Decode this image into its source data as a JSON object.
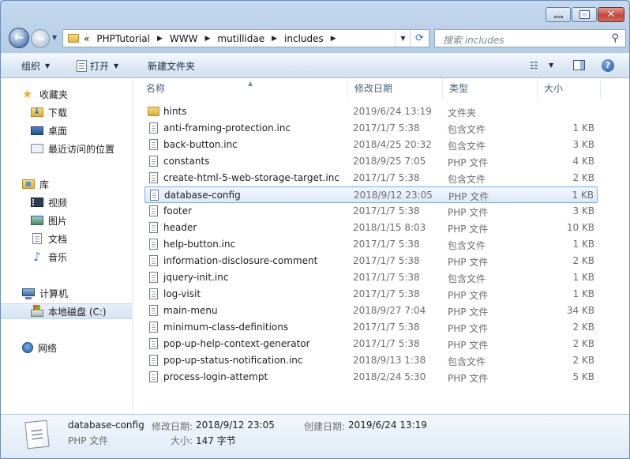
{
  "title_bar": {
    "minimize": "minimize",
    "maximize": "maximize",
    "close": "close"
  },
  "address": {
    "overflow": "«",
    "crumbs": [
      "PHPTutorial",
      "WWW",
      "mutillidae",
      "includes"
    ]
  },
  "search": {
    "placeholder": "搜索 includes"
  },
  "toolbar": {
    "organize": "组织",
    "open": "打开",
    "new_folder": "新建文件夹"
  },
  "sidebar": {
    "favorites": {
      "header": "收藏夹",
      "items": [
        "下载",
        "桌面",
        "最近访问的位置"
      ]
    },
    "libraries": {
      "header": "库",
      "items": [
        "视频",
        "图片",
        "文档",
        "音乐"
      ]
    },
    "computer": {
      "header": "计算机",
      "items": [
        "本地磁盘 (C:)"
      ]
    },
    "network": {
      "header": "网络"
    }
  },
  "columns": {
    "name": "名称",
    "date": "修改日期",
    "type": "类型",
    "size": "大小"
  },
  "files": [
    {
      "name": "hints",
      "date": "2019/6/24 13:19",
      "type": "文件夹",
      "size": "",
      "kind": "folder"
    },
    {
      "name": "anti-framing-protection.inc",
      "date": "2017/1/7 5:38",
      "type": "包含文件",
      "size": "1 KB",
      "kind": "file"
    },
    {
      "name": "back-button.inc",
      "date": "2018/4/25 20:32",
      "type": "包含文件",
      "size": "3 KB",
      "kind": "file"
    },
    {
      "name": "constants",
      "date": "2018/9/25 7:05",
      "type": "PHP 文件",
      "size": "4 KB",
      "kind": "file"
    },
    {
      "name": "create-html-5-web-storage-target.inc",
      "date": "2017/1/7 5:38",
      "type": "包含文件",
      "size": "2 KB",
      "kind": "file"
    },
    {
      "name": "database-config",
      "date": "2018/9/12 23:05",
      "type": "PHP 文件",
      "size": "1 KB",
      "kind": "file",
      "selected": true
    },
    {
      "name": "footer",
      "date": "2017/1/7 5:38",
      "type": "PHP 文件",
      "size": "3 KB",
      "kind": "file"
    },
    {
      "name": "header",
      "date": "2018/1/15 8:03",
      "type": "PHP 文件",
      "size": "10 KB",
      "kind": "file"
    },
    {
      "name": "help-button.inc",
      "date": "2017/1/7 5:38",
      "type": "包含文件",
      "size": "1 KB",
      "kind": "file"
    },
    {
      "name": "information-disclosure-comment",
      "date": "2017/1/7 5:38",
      "type": "PHP 文件",
      "size": "2 KB",
      "kind": "file"
    },
    {
      "name": "jquery-init.inc",
      "date": "2017/1/7 5:38",
      "type": "包含文件",
      "size": "1 KB",
      "kind": "file"
    },
    {
      "name": "log-visit",
      "date": "2017/1/7 5:38",
      "type": "PHP 文件",
      "size": "1 KB",
      "kind": "file"
    },
    {
      "name": "main-menu",
      "date": "2018/9/27 7:04",
      "type": "PHP 文件",
      "size": "34 KB",
      "kind": "file"
    },
    {
      "name": "minimum-class-definitions",
      "date": "2017/1/7 5:38",
      "type": "PHP 文件",
      "size": "2 KB",
      "kind": "file"
    },
    {
      "name": "pop-up-help-context-generator",
      "date": "2017/1/7 5:38",
      "type": "PHP 文件",
      "size": "2 KB",
      "kind": "file"
    },
    {
      "name": "pop-up-status-notification.inc",
      "date": "2018/9/13 1:38",
      "type": "包含文件",
      "size": "2 KB",
      "kind": "file"
    },
    {
      "name": "process-login-attempt",
      "date": "2018/2/24 5:30",
      "type": "PHP 文件",
      "size": "5 KB",
      "kind": "file"
    }
  ],
  "details": {
    "name": "database-config",
    "type": "PHP 文件",
    "modified_label": "修改日期:",
    "modified": "2018/9/12 23:05",
    "created_label": "创建日期:",
    "created": "2019/6/24 13:19",
    "size_label": "大小:",
    "size": "147 字节"
  }
}
